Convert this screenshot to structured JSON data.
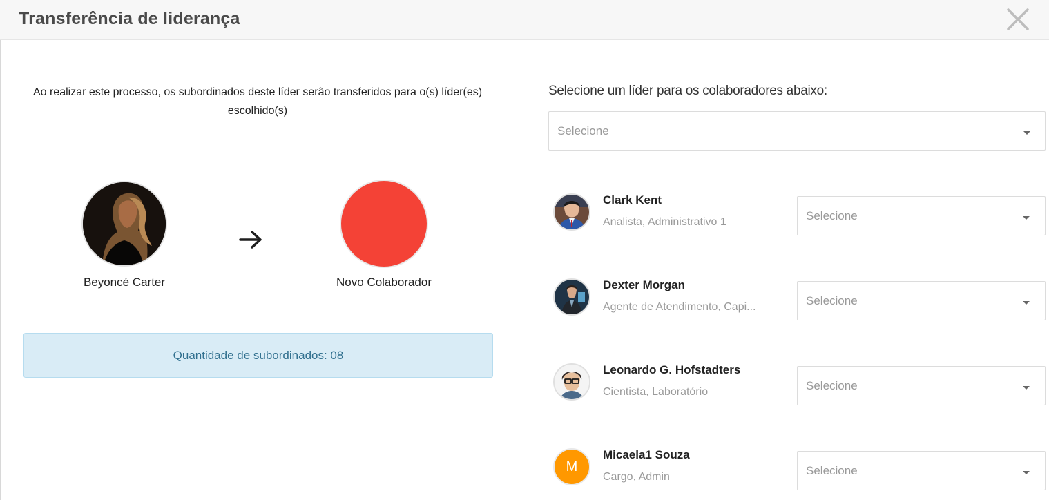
{
  "modal": {
    "title": "Transferência de liderança",
    "close_icon": "close-icon"
  },
  "left": {
    "description": "Ao realizar este processo, os subordinados deste líder serão transferidos para o(s) líder(es) escolhido(s)",
    "current_leader": {
      "name": "Beyoncé Carter",
      "avatar": "photo-avatar"
    },
    "arrow_icon": "arrow-right-icon",
    "new_leader": {
      "name": "Novo Colaborador",
      "avatar_color": "#f44236"
    },
    "subordinates_info": "Quantidade de subordinados: 08"
  },
  "right": {
    "label": "Selecione um líder para os colaboradores abaixo:",
    "main_select": {
      "placeholder": "Selecione"
    },
    "employees": [
      {
        "name": "Clark Kent",
        "role": "Analista, Administrativo 1",
        "select_placeholder": "Selecione"
      },
      {
        "name": "Dexter Morgan",
        "role": "Agente de Atendimento, Capi...",
        "select_placeholder": "Selecione"
      },
      {
        "name": "Leonardo G. Hofstadters",
        "role": "Cientista, Laboratório",
        "select_placeholder": "Selecione"
      },
      {
        "name": "Micaela1 Souza",
        "role": "Cargo, Admin",
        "initial": "M",
        "initial_color": "#ff9800",
        "select_placeholder": "Selecione"
      }
    ]
  },
  "colors": {
    "info_bg": "#d9ecf6",
    "info_text": "#31708f",
    "header_bg": "#f7f7f7"
  }
}
